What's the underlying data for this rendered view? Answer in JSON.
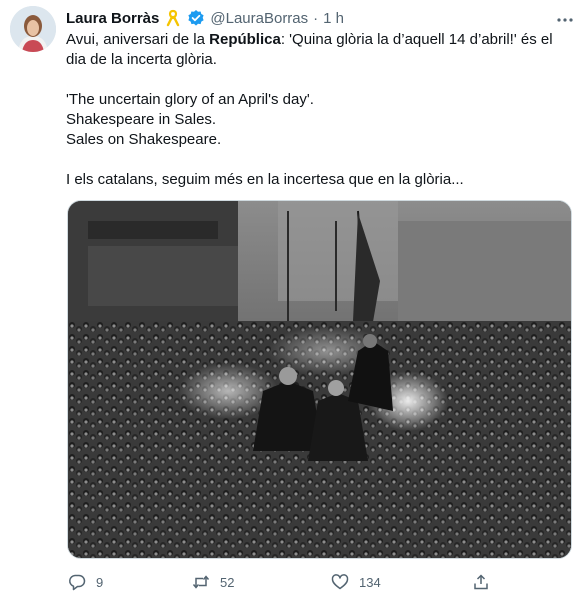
{
  "tweet": {
    "author_name": "Laura Borràs",
    "handle": "@LauraBorras",
    "separator": "·",
    "time": "1 h",
    "line1_before": "Avui, aniversari de la ",
    "line1_bold": "República",
    "line1_after": ": 'Quina glòria la d’aquell 14 d’abril!' és el dia de la incerta glòria.",
    "quote_line1": "'The uncertain glory of an April's day'.",
    "quote_line2": "Shakespeare in Sales.",
    "quote_line3": "Sales on Shakespeare.",
    "closing": "I els catalans, seguim més en la incertesa que en la glòria..."
  },
  "icons": {
    "ribbon": "yellow-ribbon-icon",
    "verified": "verified-badge-icon",
    "more": "more-options-icon",
    "reply": "reply-icon",
    "retweet": "retweet-icon",
    "like": "like-icon",
    "share": "share-icon"
  },
  "stats": {
    "replies": "9",
    "retweets": "52",
    "likes": "134"
  },
  "colors": {
    "text": "#0f1419",
    "secondary": "#536471",
    "verified": "#1d9bf0",
    "ribbon": "#f5c400"
  }
}
